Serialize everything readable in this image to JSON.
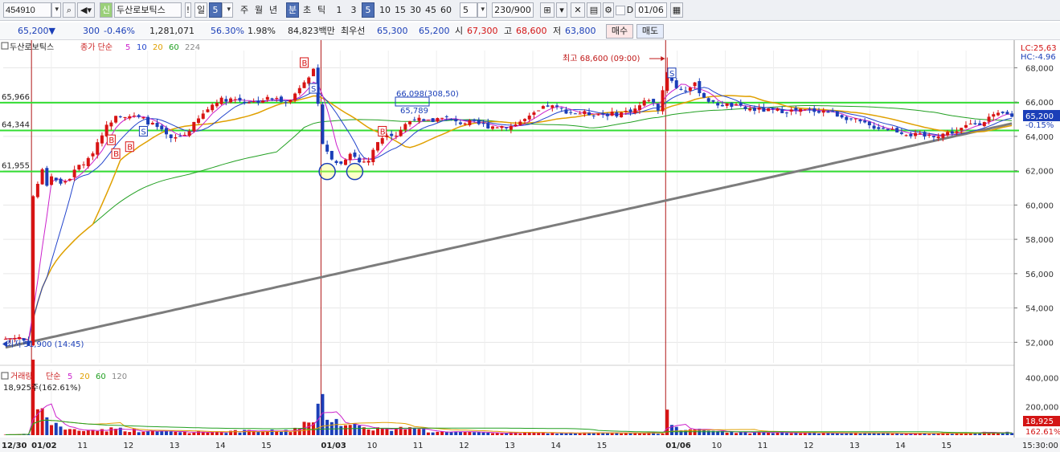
{
  "toolbar": {
    "code": "454910",
    "stock_badge": "신",
    "stock_name": "두산로보틱스",
    "period_day": "일",
    "period_value": "5",
    "week": "주",
    "month": "월",
    "year": "년",
    "minute": "분",
    "second": "초",
    "tick": "틱",
    "intervals": [
      "1",
      "3",
      "5",
      "10",
      "15",
      "30",
      "45",
      "60"
    ],
    "interval_custom": "5",
    "bar_count": "230/900",
    "date_check_label": "D",
    "date_value": "01/06"
  },
  "quote": {
    "price": "65,200▼",
    "change": "300",
    "change_pct": "-0.46%",
    "volume": "1,281,071",
    "vol_ratio": "56.30%",
    "turnover_ratio": "1.98%",
    "trade_value": "84,823백만",
    "best_label": "최우선",
    "ask": "65,300",
    "bid": "65,200",
    "open_label": "시",
    "open": "67,300",
    "high_label": "고",
    "high": "68,600",
    "low_label": "저",
    "low": "63,800",
    "buy_button": "매수",
    "sell_button": "매도"
  },
  "legend": {
    "name": "두산로보틱스",
    "series": "종가 단순",
    "ma": [
      "5",
      "10",
      "20",
      "60",
      "224"
    ],
    "ma_colors": [
      "#cc22cc",
      "#2244cc",
      "#e0a000",
      "#22a022",
      "#888888"
    ]
  },
  "annotations": {
    "high_marker": "최고 68,600 (09:00)",
    "low_marker": "최저 51,900 (14:45)",
    "box_label": "66,098(308,50)",
    "box_label2": "65,789",
    "lc": "LC:25,63",
    "hc": "HC:-4.96",
    "price_tag": "65,200",
    "price_pct": "-0.15%",
    "vol_tag": "18,925",
    "vol_pct_tag": "162.61%",
    "signals": [
      "B",
      "B",
      "B",
      "S",
      "B",
      "S",
      "B",
      "S"
    ]
  },
  "volume_legend": {
    "title": "거래량",
    "series": "단순",
    "ma": [
      "5",
      "20",
      "60",
      "120"
    ],
    "current": "18,925주(162.61%)"
  },
  "colors": {
    "up": "#d81414",
    "down": "#1b3fb8",
    "level_line": "#33dd33",
    "separator": "#b01818",
    "ma224": "#7c7c7c"
  },
  "chart_data": {
    "type": "candlestick",
    "y_axis": {
      "range": [
        50800,
        69000
      ],
      "ticks": [
        "68,000",
        "66,000",
        "64,000",
        "62,000",
        "60,000",
        "58,000",
        "56,000",
        "54,000",
        "52,000"
      ]
    },
    "volume_axis": {
      "range": [
        0,
        460000
      ],
      "ticks": [
        "400,000",
        "200,000"
      ]
    },
    "x_ticks": [
      "12/30",
      "01/02",
      "11",
      "12",
      "13",
      "14",
      "15",
      "01/03",
      "10",
      "11",
      "12",
      "13",
      "14",
      "15",
      "01/06",
      "10",
      "11",
      "12",
      "13",
      "14",
      "15",
      "15:30:00"
    ],
    "levels": [
      {
        "label": "65,966",
        "value": 65966
      },
      {
        "label": "64,344",
        "value": 64344
      },
      {
        "label": "61,955",
        "value": 61955
      }
    ],
    "anchors": {
      "price": [
        [
          0,
          52200
        ],
        [
          3,
          52300
        ],
        [
          5,
          51900
        ],
        [
          6,
          60500
        ],
        [
          8,
          62000
        ],
        [
          9,
          61200
        ],
        [
          10,
          61700
        ],
        [
          12,
          61200
        ],
        [
          14,
          61600
        ],
        [
          16,
          62300
        ],
        [
          18,
          62600
        ],
        [
          21,
          64200
        ],
        [
          24,
          65300
        ],
        [
          27,
          65200
        ],
        [
          30,
          65000
        ],
        [
          33,
          64500
        ],
        [
          36,
          63800
        ],
        [
          39,
          64100
        ],
        [
          41,
          64700
        ],
        [
          44,
          65600
        ],
        [
          46,
          66100
        ],
        [
          49,
          66200
        ],
        [
          54,
          66000
        ],
        [
          57,
          66200
        ],
        [
          62,
          66100
        ],
        [
          65,
          67300
        ],
        [
          67,
          67800
        ],
        [
          69,
          63700
        ],
        [
          71,
          62600
        ],
        [
          73,
          62400
        ],
        [
          75,
          63100
        ],
        [
          77,
          62500
        ],
        [
          79,
          62600
        ],
        [
          81,
          63700
        ],
        [
          83,
          64200
        ],
        [
          85,
          64100
        ],
        [
          87,
          64700
        ],
        [
          89,
          65100
        ],
        [
          91,
          64800
        ],
        [
          93,
          64900
        ],
        [
          95,
          65200
        ],
        [
          98,
          64800
        ],
        [
          101,
          64800
        ],
        [
          105,
          64600
        ],
        [
          110,
          64600
        ],
        [
          114,
          65100
        ],
        [
          118,
          65800
        ],
        [
          123,
          65400
        ],
        [
          128,
          65300
        ],
        [
          133,
          65300
        ],
        [
          137,
          65600
        ],
        [
          140,
          66200
        ],
        [
          142,
          65600
        ],
        [
          144,
          67800
        ],
        [
          146,
          66800
        ],
        [
          148,
          66700
        ],
        [
          150,
          67000
        ],
        [
          152,
          66300
        ],
        [
          154,
          65900
        ],
        [
          158,
          65800
        ],
        [
          161,
          65600
        ],
        [
          166,
          65500
        ],
        [
          172,
          65500
        ],
        [
          178,
          65500
        ],
        [
          183,
          65100
        ],
        [
          188,
          64600
        ],
        [
          193,
          64400
        ],
        [
          197,
          64100
        ],
        [
          200,
          64000
        ],
        [
          203,
          64100
        ],
        [
          207,
          64300
        ],
        [
          210,
          64700
        ],
        [
          212,
          64800
        ],
        [
          214,
          65100
        ],
        [
          217,
          65300
        ],
        [
          219,
          65200
        ]
      ],
      "volume": [
        [
          0,
          2000
        ],
        [
          5,
          8000
        ],
        [
          6,
          380000
        ],
        [
          7,
          250000
        ],
        [
          8,
          140000
        ],
        [
          10,
          90000
        ],
        [
          12,
          60000
        ],
        [
          14,
          35000
        ],
        [
          20,
          35000
        ],
        [
          24,
          45000
        ],
        [
          30,
          28000
        ],
        [
          40,
          22000
        ],
        [
          50,
          26000
        ],
        [
          62,
          30000
        ],
        [
          65,
          85000
        ],
        [
          67,
          70000
        ],
        [
          69,
          260000
        ],
        [
          70,
          150000
        ],
        [
          72,
          110000
        ],
        [
          74,
          80000
        ],
        [
          78,
          55000
        ],
        [
          85,
          35000
        ],
        [
          88,
          70000
        ],
        [
          92,
          25000
        ],
        [
          100,
          18000
        ],
        [
          120,
          15000
        ],
        [
          140,
          14000
        ],
        [
          143,
          16000
        ],
        [
          144,
          180000
        ],
        [
          145,
          90000
        ],
        [
          147,
          55000
        ],
        [
          150,
          35000
        ],
        [
          160,
          20000
        ],
        [
          180,
          14000
        ],
        [
          200,
          12000
        ],
        [
          219,
          18925
        ]
      ]
    },
    "markers": {
      "high": 68600,
      "low": 51900
    }
  }
}
